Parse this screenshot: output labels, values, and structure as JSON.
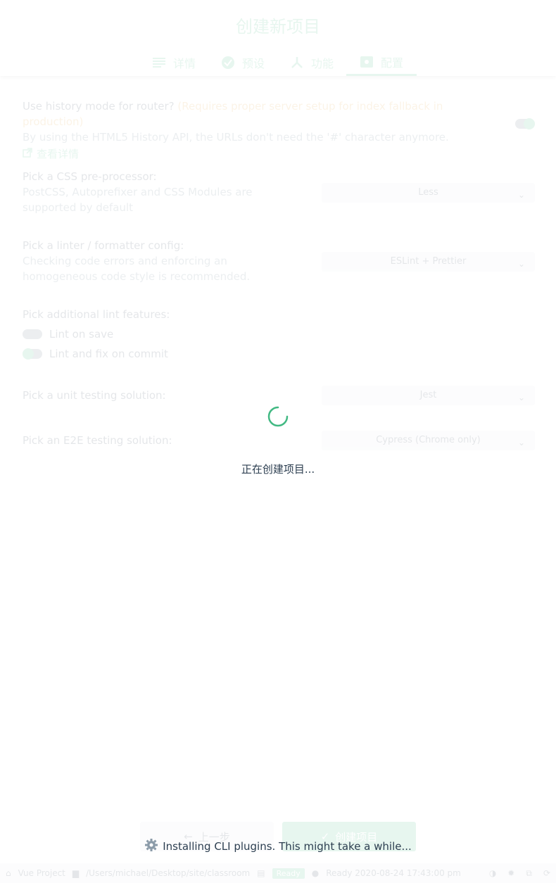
{
  "header": {
    "title": "创建新项目",
    "tabs": [
      {
        "label": "详情",
        "icon": "list-icon"
      },
      {
        "label": "预设",
        "icon": "check-circle-icon"
      },
      {
        "label": "功能",
        "icon": "merge-icon"
      },
      {
        "label": "配置",
        "icon": "settings-app-icon"
      }
    ]
  },
  "config": {
    "history": {
      "question": "Use history mode for router?",
      "warning": "(Requires proper server setup for index fallback in production)",
      "description": "By using the HTML5 History API, the URLs don't need the '#' character anymore.",
      "link": "查看详情"
    },
    "css": {
      "question": "Pick a CSS pre-processor:",
      "description": "PostCSS, Autoprefixer and CSS Modules are supported by default",
      "value": "Less"
    },
    "linter": {
      "question": "Pick a linter / formatter config:",
      "description": "Checking code errors and enforcing an homogeneous code style is recommended.",
      "value": "ESLint + Prettier"
    },
    "lint_features": {
      "question": "Pick additional lint features:",
      "options": [
        "Lint on save",
        "Lint and fix on commit"
      ]
    },
    "unit": {
      "question": "Pick a unit testing solution:",
      "value": "Jest"
    },
    "e2e": {
      "question": "Pick an E2E testing solution:",
      "value": "Cypress (Chrome only)"
    }
  },
  "footer": {
    "prev_label": "上一步",
    "create_label": "创建项目"
  },
  "statusbar": {
    "home": "Vue Project",
    "path": "/Users/michael/Desktop/site/classroom",
    "badge": "Ready",
    "info": "Ready 2020-08-24 17:43:00 pm"
  },
  "overlay": {
    "loading": "正在创建项目...",
    "install": "Installing CLI plugins. This might take a while..."
  },
  "colors": {
    "accent": "#42b983",
    "warning": "#e6a23c"
  }
}
